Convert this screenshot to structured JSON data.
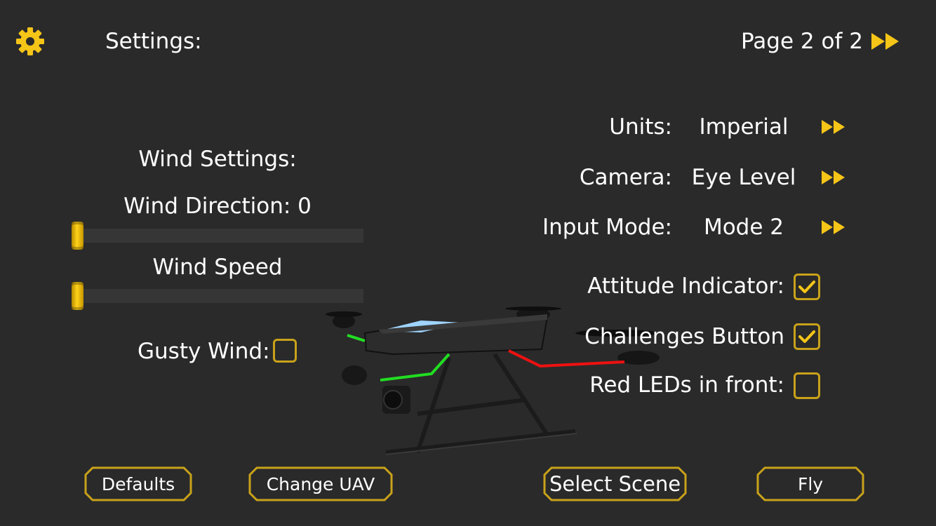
{
  "header": {
    "title": "Settings:",
    "page_indicator": "Page 2 of 2",
    "next_icon": "fast-forward-icon",
    "settings_icon": "gear-icon"
  },
  "wind": {
    "title": "Wind Settings:",
    "direction_label": "Wind Direction: 0",
    "direction_value": 0,
    "speed_label": "Wind Speed",
    "speed_value": 0,
    "gusty_label": "Gusty Wind:",
    "gusty_checked": false
  },
  "options": {
    "units": {
      "label": "Units:",
      "value": "Imperial"
    },
    "camera": {
      "label": "Camera:",
      "value": "Eye Level"
    },
    "input_mode": {
      "label": "Input Mode:",
      "value": "Mode 2"
    }
  },
  "toggles": {
    "attitude_indicator": {
      "label": "Attitude Indicator:",
      "checked": true
    },
    "challenges_button": {
      "label": "Challenges Button",
      "checked": true
    },
    "red_leds_front": {
      "label": "Red LEDs in front:",
      "checked": false
    }
  },
  "buttons": {
    "defaults": "Defaults",
    "change_uav": "Change UAV",
    "select_scene": "Select Scene",
    "fly": "Fly"
  },
  "colors": {
    "background": "#2a2a2a",
    "accent": "#f5c518",
    "button_border": "#c9a21a",
    "text": "#ffffff"
  }
}
